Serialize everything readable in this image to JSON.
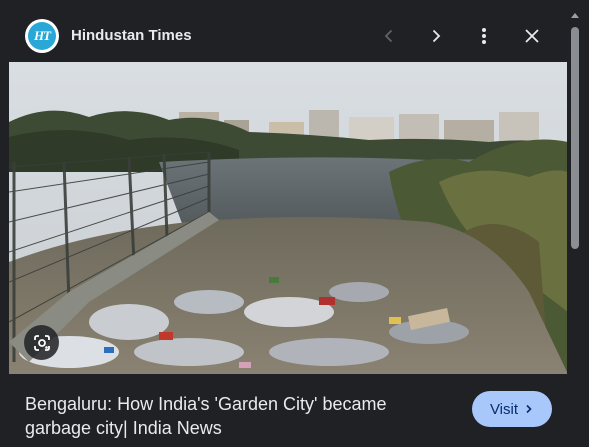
{
  "header": {
    "logo_text": "HT",
    "source_name": "Hindustan Times",
    "prev_icon": "chevron-left-icon",
    "next_icon": "chevron-right-icon",
    "more_icon": "more-vert-icon",
    "close_icon": "close-icon"
  },
  "image": {
    "lens_icon": "google-lens-icon"
  },
  "caption": {
    "title": "Bengaluru: How India's 'Garden City' became garbage city| India News"
  },
  "visit": {
    "label": "Visit"
  },
  "colors": {
    "panel_bg": "#202124",
    "text": "#e8eaed",
    "visit_bg": "#a8c7fa",
    "visit_text": "#062e6f",
    "logo_blue": "#29a8d8"
  }
}
